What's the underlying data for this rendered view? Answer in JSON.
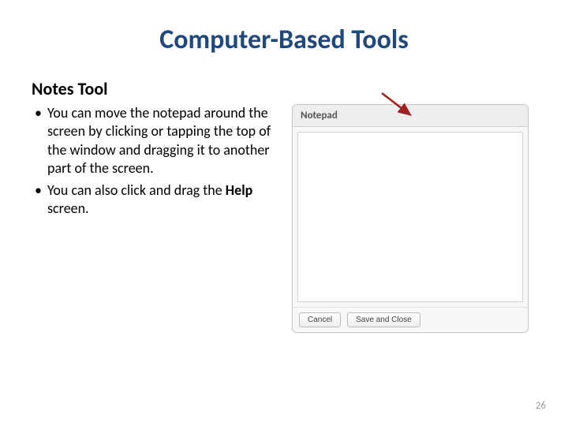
{
  "title": "Computer-Based Tools",
  "subtitle": "Notes Tool",
  "bullets": {
    "b1_part1": "You can move the notepad around the screen by clicking or tapping the top of the window and dragging it to another part of the screen.",
    "b2_prefix": "You can also click and drag the ",
    "b2_bold": "Help",
    "b2_suffix": " screen."
  },
  "notepad": {
    "header": "Notepad",
    "cancel": "Cancel",
    "save": "Save and Close"
  },
  "pageNumber": "26"
}
